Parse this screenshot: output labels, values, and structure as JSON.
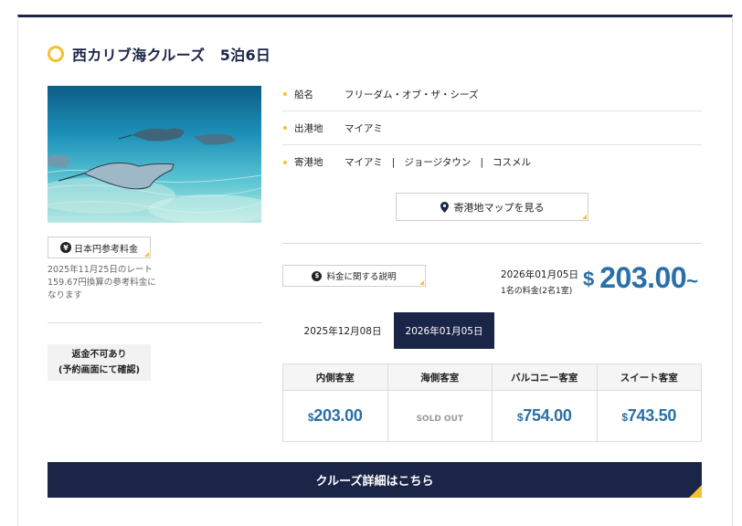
{
  "cruise": {
    "title": "西カリブ海クルーズ　5泊6日"
  },
  "info": {
    "ship_label": "船名",
    "ship_value": "フリーダム・オブ・ザ・シーズ",
    "departure_label": "出港地",
    "departure_value": "マイアミ",
    "ports_label": "寄港地",
    "ports": [
      "マイアミ",
      "ジョージタウン",
      "コスメル"
    ],
    "port_separator": "|",
    "map_button": "寄港地マップを見る"
  },
  "yen": {
    "button": "日本円参考料金",
    "icon_glyph": "¥",
    "note_line1": "2025年11月25日のレート",
    "note_line2": "159.67円換算の参考料金に",
    "note_line3": "なります"
  },
  "refund": {
    "line1": "返金不可あり",
    "line2": "(予約画面にて確認)"
  },
  "fee": {
    "button": "料金に関する説明",
    "icon_glyph": "$"
  },
  "price": {
    "date": "2026年01月05日",
    "note": "1名の料金(2名1室)",
    "currency": "$",
    "amount": "203.00",
    "suffix": "~"
  },
  "date_tabs": [
    {
      "label": "2025年12月08日",
      "active": false
    },
    {
      "label": "2026年01月05日",
      "active": true
    }
  ],
  "cabins": {
    "headers": [
      "内側客室",
      "海側客室",
      "バルコニー客室",
      "スイート客室"
    ],
    "prices": [
      {
        "currency": "$",
        "value": "203.00"
      },
      {
        "soldout": "SOLD OUT"
      },
      {
        "currency": "$",
        "value": "754.00"
      },
      {
        "currency": "$",
        "value": "743.50"
      }
    ]
  },
  "detail_button": "クルーズ詳細はこちら",
  "colors": {
    "navy": "#1b2547",
    "accent_yellow": "#f2c230",
    "price_blue": "#2a6fa7"
  }
}
